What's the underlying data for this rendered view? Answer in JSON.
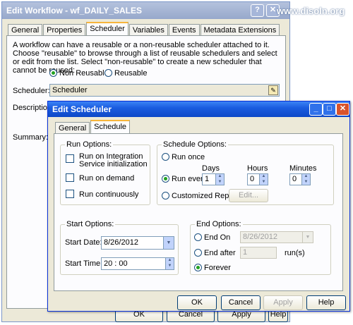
{
  "edit_workflow": {
    "title": "Edit Workflow - wf_DAILY_SALES",
    "tabs": [
      "General",
      "Properties",
      "Scheduler",
      "Variables",
      "Events",
      "Metadata Extensions"
    ],
    "description_text": "A workflow can have a reusable or a non-reusable scheduler attached to it.  Choose \"reusable\" to browse through a list of reusable schedulers and select or edit from the list.  Select \"non-reusable\" to create a new scheduler that cannot be reused:",
    "radio_non_reusable": "Non Reusable",
    "radio_reusable": "Reusable",
    "scheduler_label": "Scheduler:",
    "scheduler_value": "Scheduler",
    "description_label": "Description:",
    "summary_label": "Summary:",
    "buttons": [
      "OK",
      "Cancel",
      "Apply",
      "Help"
    ]
  },
  "watermark": "www.disoln.org",
  "edit_scheduler": {
    "title": "Edit Scheduler",
    "tabs": [
      "General",
      "Schedule"
    ],
    "run_options": {
      "title": "Run Options:",
      "integration": "Run on Integration Service initialization",
      "integration_line1": "Run on Integration",
      "integration_line2": "Service initialization",
      "demand": "Run on demand",
      "continuously": "Run continuously"
    },
    "schedule_options": {
      "title": "Schedule Options:",
      "run_once": "Run once",
      "run_every": "Run every",
      "days_label": "Days",
      "hours_label": "Hours",
      "minutes_label": "Minutes",
      "days": "1",
      "hours": "0",
      "minutes": "0",
      "customized": "Customized Repeat",
      "edit_button": "Edit..."
    },
    "start_options": {
      "title": "Start Options:",
      "date_label": "Start Date:",
      "date_value": "8/26/2012",
      "time_label": "Start Time:",
      "time_value": "20 : 00"
    },
    "end_options": {
      "title": "End Options:",
      "end_on": "End On",
      "end_on_value": "8/26/2012",
      "end_after": "End after",
      "end_after_value": "1",
      "runs": "run(s)",
      "forever": "Forever"
    },
    "buttons": [
      "OK",
      "Cancel",
      "Apply",
      "Help"
    ]
  }
}
